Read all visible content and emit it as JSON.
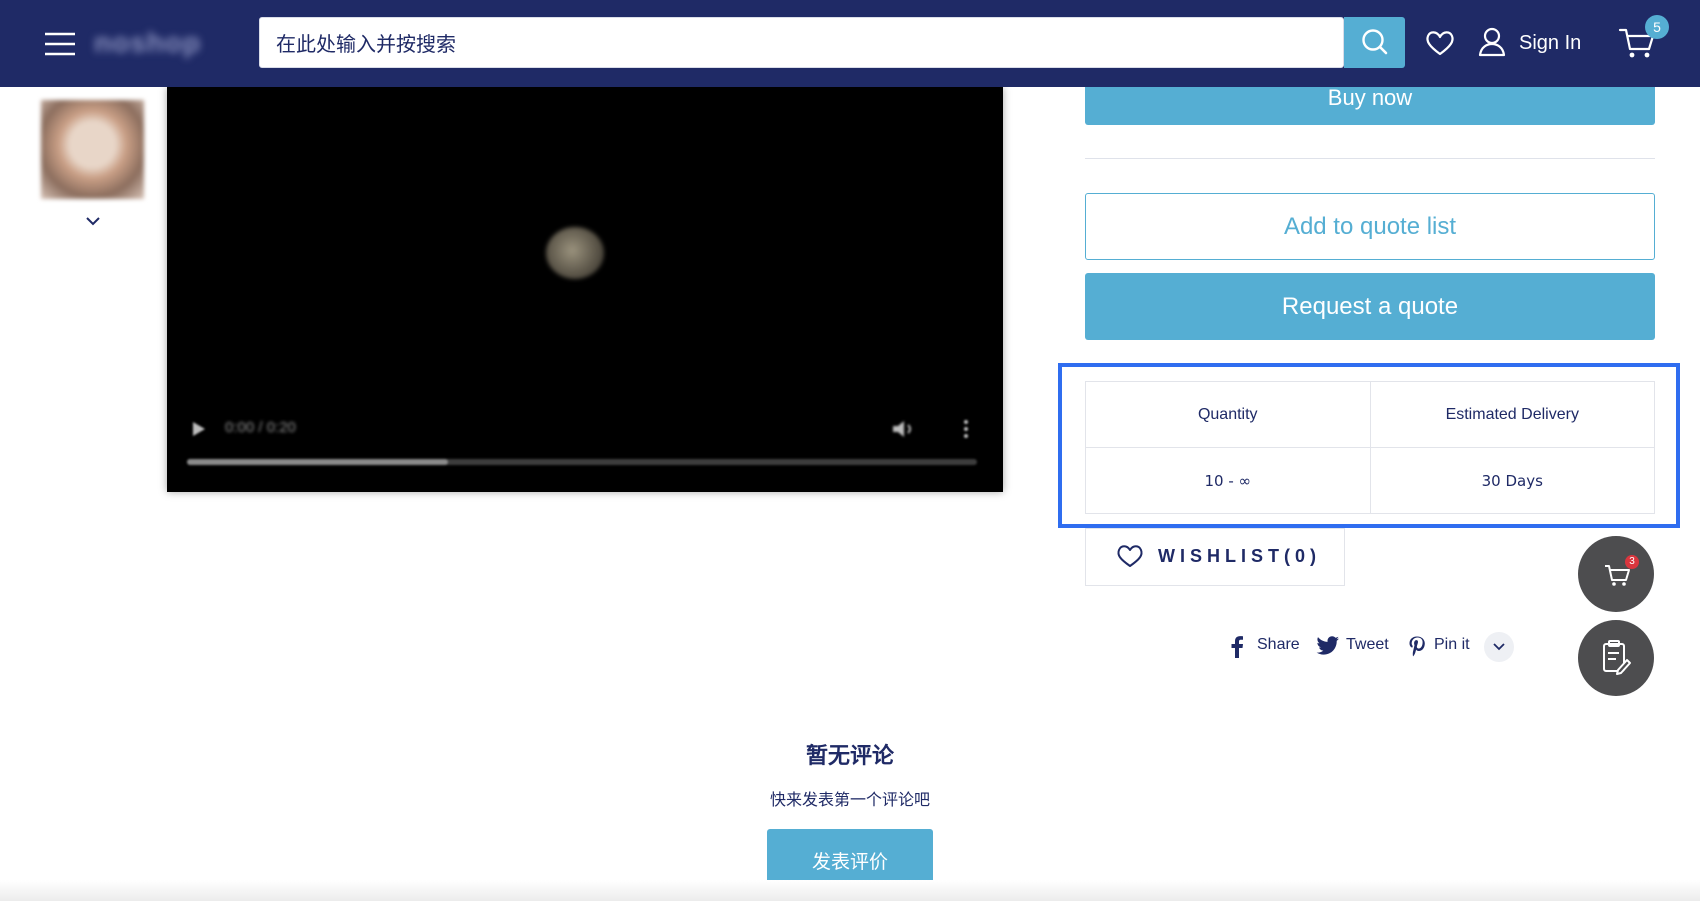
{
  "header": {
    "logo_text": "noshop",
    "search_placeholder": "在此处输入并按搜索",
    "sign_in_label": "Sign In",
    "cart_count": "5",
    "icons": [
      "menu-icon",
      "search-icon",
      "heart-icon",
      "user-icon",
      "cart-icon"
    ],
    "bg_color": "#1f2a66",
    "accent_color": "#55aed3"
  },
  "video": {
    "time_text": "0:00 / 0:20",
    "progress": 0.33
  },
  "product": {
    "buy_now_label": "Buy now",
    "add_to_quote_label": "Add to quote list",
    "request_quote_label": "Request a quote",
    "delivery_table": {
      "headers": [
        "Quantity",
        "Estimated Delivery"
      ],
      "rows": [
        [
          "10 - ∞",
          "30 Days"
        ]
      ]
    },
    "wishlist_label": "WISHLIST(0)",
    "share": [
      {
        "label": "Share",
        "icon": "facebook-icon"
      },
      {
        "label": "Tweet",
        "icon": "twitter-icon"
      },
      {
        "label": "Pin it",
        "icon": "pinterest-icon"
      }
    ]
  },
  "floating": {
    "quote_cart_count": "3",
    "icons": [
      "quote-cart-icon",
      "clipboard-edit-icon"
    ]
  },
  "reviews": {
    "title": "暂无评论",
    "subtitle": "快来发表第一个评论吧",
    "button_label": "发表评价"
  }
}
